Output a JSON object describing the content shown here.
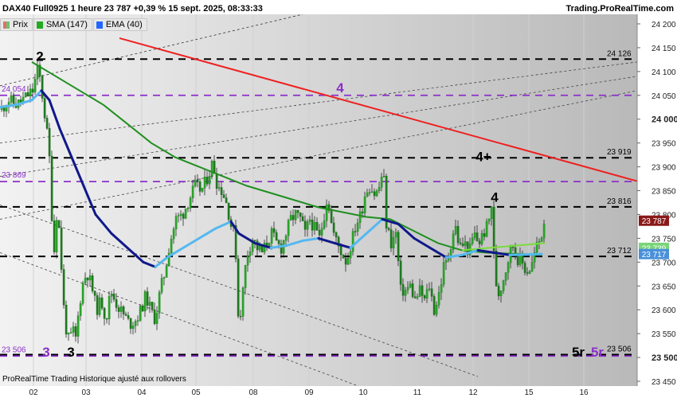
{
  "header": {
    "title": "DAX40 Full0925 1 heure 23 787 +0,39 % 15 sept. 2025, 08:33:33",
    "source": "Trading.ProRealTime.com",
    "footer": "ProRealTime Trading  Historique ajusté aux rollovers"
  },
  "legend": [
    {
      "label": "Prix",
      "color": "#d9a0a0"
    },
    {
      "label": "SMA (147)",
      "color": "#00aa00"
    },
    {
      "label": "EMA (40)",
      "color": "#4aa8ff"
    }
  ],
  "chart_data": {
    "type": "candlestick",
    "instrument": "DAX40 Full0925",
    "timeframe": "1 heure",
    "last": 23787,
    "change_pct": 0.39,
    "ylim": [
      23450,
      24220
    ],
    "y_ticks": [
      23450,
      23500,
      23550,
      23600,
      23650,
      23700,
      23750,
      23800,
      23850,
      23900,
      23950,
      24000,
      24050,
      24100,
      24150,
      24200
    ],
    "x_labels": [
      "02",
      "03",
      "04",
      "05",
      "08",
      "09",
      "10",
      "11",
      "12",
      "15",
      "16"
    ],
    "price_points": [
      [
        0,
        24020
      ],
      [
        10,
        24040
      ],
      [
        20,
        24030
      ],
      [
        30,
        24045
      ],
      [
        40,
        24060
      ],
      [
        47,
        24110
      ],
      [
        52,
        24050
      ],
      [
        58,
        23970
      ],
      [
        62,
        23900
      ],
      [
        66,
        23700
      ],
      [
        70,
        23800
      ],
      [
        74,
        23760
      ],
      [
        78,
        23620
      ],
      [
        82,
        23560
      ],
      [
        86,
        23530
      ],
      [
        90,
        23560
      ],
      [
        94,
        23540
      ],
      [
        98,
        23600
      ],
      [
        102,
        23650
      ],
      [
        108,
        23680
      ],
      [
        114,
        23650
      ],
      [
        120,
        23600
      ],
      [
        126,
        23620
      ],
      [
        132,
        23580
      ],
      [
        138,
        23640
      ],
      [
        146,
        23610
      ],
      [
        154,
        23590
      ],
      [
        162,
        23570
      ],
      [
        170,
        23580
      ],
      [
        176,
        23600
      ],
      [
        182,
        23630
      ],
      [
        188,
        23600
      ],
      [
        194,
        23580
      ],
      [
        200,
        23640
      ],
      [
        206,
        23680
      ],
      [
        212,
        23740
      ],
      [
        220,
        23790
      ],
      [
        228,
        23800
      ],
      [
        236,
        23830
      ],
      [
        244,
        23860
      ],
      [
        252,
        23850
      ],
      [
        260,
        23880
      ],
      [
        266,
        23910
      ],
      [
        272,
        23860
      ],
      [
        278,
        23850
      ],
      [
        284,
        23820
      ],
      [
        290,
        23770
      ],
      [
        294,
        23760
      ],
      [
        298,
        23590
      ],
      [
        302,
        23600
      ],
      [
        306,
        23680
      ],
      [
        310,
        23720
      ],
      [
        316,
        23750
      ],
      [
        322,
        23730
      ],
      [
        328,
        23720
      ],
      [
        334,
        23740
      ],
      [
        340,
        23760
      ],
      [
        346,
        23740
      ],
      [
        352,
        23730
      ],
      [
        358,
        23760
      ],
      [
        364,
        23790
      ],
      [
        370,
        23800
      ],
      [
        376,
        23790
      ],
      [
        382,
        23760
      ],
      [
        388,
        23790
      ],
      [
        394,
        23770
      ],
      [
        400,
        23750
      ],
      [
        406,
        23800
      ],
      [
        410,
        23840
      ],
      [
        416,
        23770
      ],
      [
        422,
        23740
      ],
      [
        428,
        23720
      ],
      [
        434,
        23700
      ],
      [
        440,
        23740
      ],
      [
        446,
        23780
      ],
      [
        452,
        23800
      ],
      [
        458,
        23850
      ],
      [
        464,
        23860
      ],
      [
        470,
        23840
      ],
      [
        476,
        23860
      ],
      [
        480,
        23900
      ],
      [
        484,
        23780
      ],
      [
        490,
        23740
      ],
      [
        496,
        23760
      ],
      [
        502,
        23640
      ],
      [
        508,
        23640
      ],
      [
        514,
        23650
      ],
      [
        520,
        23620
      ],
      [
        526,
        23640
      ],
      [
        532,
        23620
      ],
      [
        538,
        23650
      ],
      [
        544,
        23600
      ],
      [
        548,
        23620
      ],
      [
        552,
        23650
      ],
      [
        556,
        23690
      ],
      [
        560,
        23700
      ],
      [
        564,
        23730
      ],
      [
        570,
        23780
      ],
      [
        576,
        23730
      ],
      [
        582,
        23740
      ],
      [
        588,
        23720
      ],
      [
        594,
        23760
      ],
      [
        600,
        23740
      ],
      [
        606,
        23760
      ],
      [
        612,
        23780
      ],
      [
        616,
        23820
      ],
      [
        620,
        23680
      ],
      [
        624,
        23630
      ],
      [
        630,
        23660
      ],
      [
        636,
        23700
      ],
      [
        642,
        23740
      ],
      [
        648,
        23710
      ],
      [
        654,
        23700
      ],
      [
        660,
        23680
      ],
      [
        666,
        23690
      ],
      [
        672,
        23730
      ],
      [
        678,
        23750
      ],
      [
        682,
        23787
      ]
    ],
    "sma147_points": [
      [
        40,
        24120
      ],
      [
        70,
        24090
      ],
      [
        100,
        24060
      ],
      [
        130,
        24030
      ],
      [
        160,
        23990
      ],
      [
        190,
        23950
      ],
      [
        220,
        23920
      ],
      [
        250,
        23900
      ],
      [
        280,
        23880
      ],
      [
        310,
        23860
      ],
      [
        340,
        23845
      ],
      [
        370,
        23830
      ],
      [
        400,
        23815
      ],
      [
        430,
        23805
      ],
      [
        460,
        23795
      ],
      [
        490,
        23790
      ],
      [
        520,
        23765
      ],
      [
        550,
        23740
      ],
      [
        580,
        23725
      ],
      [
        610,
        23720
      ],
      [
        640,
        23718
      ],
      [
        660,
        23717
      ],
      [
        680,
        23715
      ]
    ],
    "sma_highlight_points": [
      [
        580,
        23725
      ],
      [
        684,
        23740
      ]
    ],
    "ema40_points": [
      [
        0,
        24025
      ],
      [
        20,
        24030
      ],
      [
        40,
        24040
      ],
      [
        52,
        24060
      ],
      [
        62,
        24040
      ],
      [
        75,
        23980
      ],
      [
        90,
        23920
      ],
      [
        105,
        23860
      ],
      [
        120,
        23800
      ],
      [
        140,
        23760
      ],
      [
        160,
        23730
      ],
      [
        180,
        23700
      ],
      [
        195,
        23690
      ],
      [
        210,
        23710
      ],
      [
        230,
        23730
      ],
      [
        250,
        23750
      ],
      [
        270,
        23770
      ],
      [
        290,
        23785
      ],
      [
        300,
        23760
      ],
      [
        320,
        23740
      ],
      [
        340,
        23730
      ],
      [
        360,
        23735
      ],
      [
        380,
        23745
      ],
      [
        400,
        23750
      ],
      [
        420,
        23740
      ],
      [
        440,
        23730
      ],
      [
        460,
        23760
      ],
      [
        480,
        23790
      ],
      [
        500,
        23780
      ],
      [
        520,
        23750
      ],
      [
        540,
        23730
      ],
      [
        560,
        23710
      ],
      [
        580,
        23715
      ],
      [
        600,
        23725
      ],
      [
        620,
        23720
      ],
      [
        640,
        23715
      ],
      [
        660,
        23716
      ],
      [
        680,
        23717
      ]
    ],
    "horizontal_levels": [
      {
        "value": 24126,
        "style": "black-dash",
        "label": "24 126"
      },
      {
        "value": 24050,
        "style": "purple-dash",
        "label": "24 054"
      },
      {
        "value": 23919,
        "style": "black-dash",
        "label": "23 919"
      },
      {
        "value": 23869,
        "style": "purple-dash",
        "label": "23 869"
      },
      {
        "value": 23816,
        "style": "black-dash",
        "label": "23 816"
      },
      {
        "value": 23712,
        "style": "black-dash",
        "label": "23 712"
      },
      {
        "value": 23506,
        "style": "black-dash",
        "label": "23 506"
      },
      {
        "value": 23503,
        "style": "purple-dash",
        "label": "23 506"
      }
    ],
    "trendline_red": {
      "from": [
        150,
        24170
      ],
      "to": [
        800,
        23870
      ]
    },
    "price_tags": [
      {
        "value": 23787,
        "label": "23 787",
        "bg": "#8a1a1a"
      },
      {
        "value": 23730,
        "label": "23 739",
        "bg": "#7ad57a"
      },
      {
        "value": 23717,
        "label": "23 717",
        "bg": "#4a90d9"
      }
    ],
    "wave_labels": [
      {
        "text": "2",
        "x": 50,
        "value": 24122,
        "color": "#000000"
      },
      {
        "text": "3",
        "x": 58,
        "value": 23502,
        "color": "#8b2fc9"
      },
      {
        "text": "3",
        "x": 89,
        "value": 23502,
        "color": "#000000"
      },
      {
        "text": "4",
        "x": 427,
        "value": 24056,
        "color": "#8b2fc9"
      },
      {
        "text": "4+",
        "x": 607,
        "value": 23912,
        "color": "#000000"
      },
      {
        "text": "4",
        "x": 621,
        "value": 23827,
        "color": "#000000"
      },
      {
        "text": "5r",
        "x": 726,
        "value": 23502,
        "color": "#000000"
      },
      {
        "text": "5r",
        "x": 750,
        "value": 23502,
        "color": "#8b2fc9"
      }
    ]
  }
}
